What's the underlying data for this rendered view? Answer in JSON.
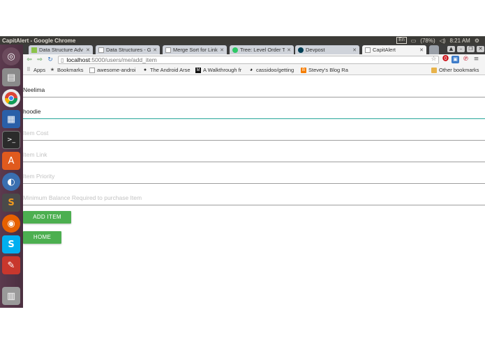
{
  "system": {
    "window_title": "CapitAlert - Google Chrome",
    "keyboard": "En",
    "battery": "(78%)",
    "time": "8:21 AM"
  },
  "browser": {
    "tabs": [
      {
        "label": "Data Structure Adv",
        "active": false
      },
      {
        "label": "Data Structures - Gr",
        "active": false
      },
      {
        "label": "Merge Sort for Link",
        "active": false
      },
      {
        "label": "Tree: Level Order Tr",
        "active": false
      },
      {
        "label": "Devpost",
        "active": false
      },
      {
        "label": "CapitAlert",
        "active": true
      }
    ],
    "url_host": "localhost",
    "url_path": ":5000/users/me/add_item",
    "bookmarks": [
      {
        "label": "Apps"
      },
      {
        "label": "Bookmarks"
      },
      {
        "label": "awesome-androi"
      },
      {
        "label": "The Android Arse"
      },
      {
        "label": "A Walkthrough fr"
      },
      {
        "label": "cassidoo/getting"
      },
      {
        "label": "Stevey's Blog Ra"
      }
    ],
    "other_bookmarks": "Other bookmarks"
  },
  "form": {
    "fields": [
      {
        "value": "Neelima",
        "placeholder": ""
      },
      {
        "value": "hoodie",
        "placeholder": ""
      },
      {
        "value": "",
        "placeholder": "Item Cost"
      },
      {
        "value": "",
        "placeholder": "Item Link"
      },
      {
        "value": "",
        "placeholder": "Item Priority"
      },
      {
        "value": "",
        "placeholder": "Minimum Balance Required to purchase Item"
      }
    ],
    "add_label": "ADD ITEM",
    "home_label": "HOME"
  },
  "colors": {
    "accent_green": "#4caf50",
    "focus_teal": "#26a69a",
    "launcher": "#5c3a4e",
    "topbar": "#3c3b37"
  },
  "icons": {
    "launcher": [
      "ubuntu-dash-icon",
      "files-icon",
      "chrome-icon",
      "libreoffice-writer-icon",
      "terminal-icon",
      "software-center-icon",
      "browser-globe-icon",
      "sublime-text-icon",
      "firefox-icon",
      "skype-icon",
      "settings-tools-icon",
      "trash-icon"
    ]
  }
}
